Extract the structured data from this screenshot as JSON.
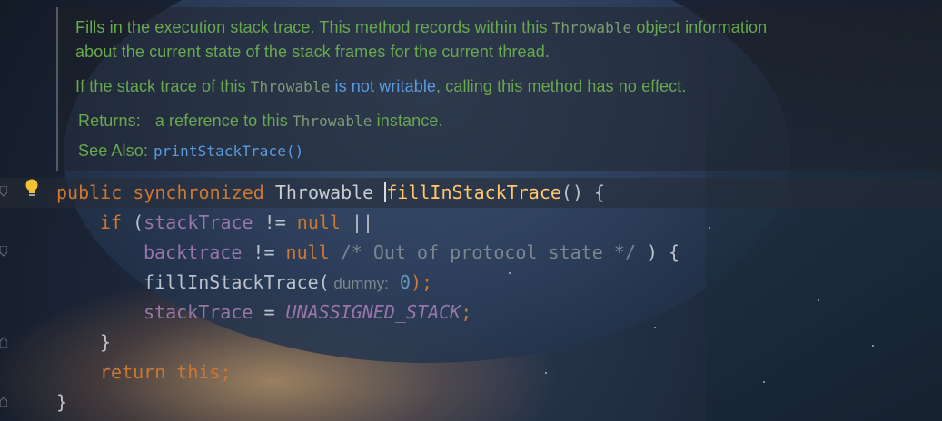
{
  "doc": {
    "p1_a": "Fills in the execution stack trace. This method records within this ",
    "p1_code": "Throwable",
    "p1_b": " object information",
    "p1_line2": "about the current state of the stack frames for the current thread.",
    "p2_a": "If the stack trace of this ",
    "p2_code": "Throwable",
    "p2_link": " is not writable",
    "p2_b": ", calling this method has no effect.",
    "returns_label": "Returns:",
    "returns_a": "a reference to this ",
    "returns_code": "Throwable",
    "returns_b": " instance.",
    "see_also_label": "See Also:",
    "see_also_link": "printStackTrace()"
  },
  "code": {
    "l1_public": "public",
    "l1_synchronized": "synchronized",
    "l1_type": "Throwable",
    "l1_method": "fillInStackTrace",
    "l1_rest": "() {",
    "l2_if": "if",
    "l2_open": " (",
    "l2_field": "stackTrace",
    "l2_op": " != ",
    "l2_null": "null",
    "l2_or": " ||",
    "l3_field": "backtrace",
    "l3_op": " != ",
    "l3_null": "null",
    "l3_comment": " /* Out of protocol state */",
    "l3_rest": " ) {",
    "l4_call": "fillInStackTrace(",
    "l4_hint": " dummy:",
    "l4_num": " 0",
    "l4_rest": ");",
    "l5_field": "stackTrace",
    "l5_eq": " = ",
    "l5_const": "UNASSIGNED_STACK",
    "l5_semi": ";",
    "l6": "}",
    "l7_return": "return",
    "l7_this": " this",
    "l7_semi": ";",
    "l8": "}"
  },
  "icons": {
    "bulb": "lightbulb-icon",
    "fold": "fold-marker-icon"
  },
  "colors": {
    "keyword": "#cc7832",
    "method": "#ffc66d",
    "field": "#9876aa",
    "doc_text": "#6aa84f",
    "link": "#5a9be0",
    "number": "#6897bb"
  }
}
